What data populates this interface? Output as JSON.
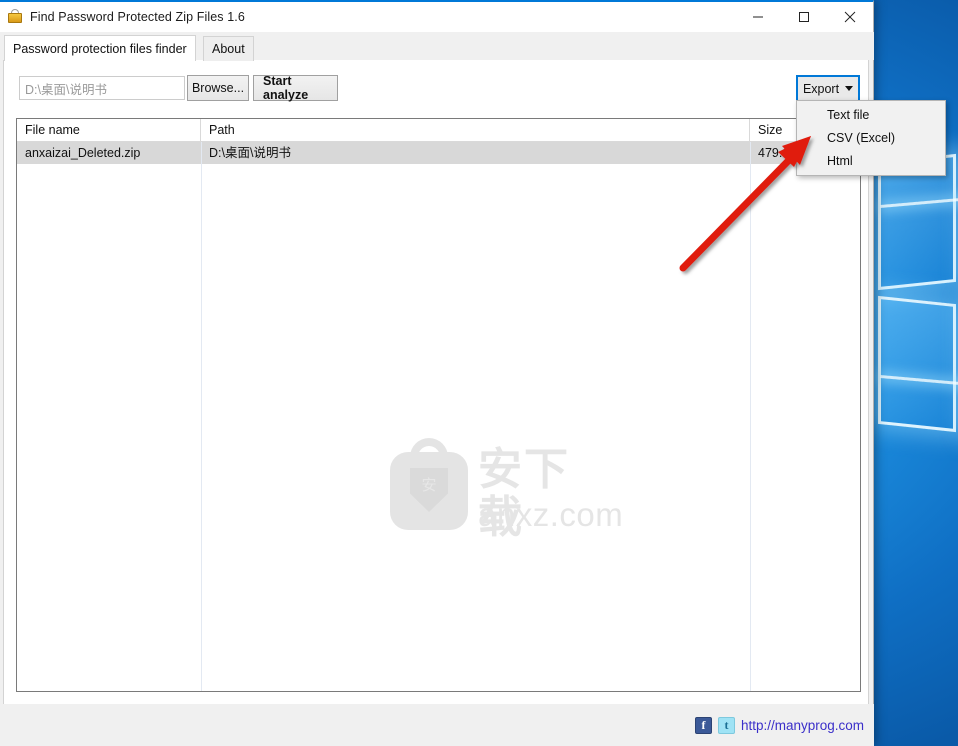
{
  "window": {
    "title": "Find Password Protected Zip Files 1.6",
    "icon": "zip-bag-icon",
    "controls": {
      "minimize": "minimize-icon",
      "maximize": "maximize-icon",
      "close": "close-icon"
    }
  },
  "tabs": [
    {
      "label": "Password protection files finder",
      "active": true
    },
    {
      "label": "About",
      "active": false
    }
  ],
  "toolbar": {
    "path_value": "D:\\桌面\\说明书",
    "path_placeholder": "D:\\桌面\\说明书",
    "browse_label": "Browse...",
    "start_label": "Start analyze",
    "export_label": "Export",
    "export_caret": "chevron-down-icon"
  },
  "export_menu": {
    "open": true,
    "items": [
      {
        "label": "Text file"
      },
      {
        "label": "CSV (Excel)"
      },
      {
        "label": "Html"
      }
    ]
  },
  "table": {
    "columns": [
      "File name",
      "Path",
      "Size"
    ],
    "rows": [
      {
        "file_name": "anxaizai_Deleted.zip",
        "path": "D:\\桌面\\说明书",
        "size": "479.6 K",
        "selected": true
      }
    ]
  },
  "watermark": {
    "cn_text": "安下载",
    "domain": "anxz.com",
    "shield_glyph": "安"
  },
  "statusbar": {
    "facebook_icon": "facebook-icon",
    "facebook_glyph": "f",
    "twitter_icon": "twitter-icon",
    "twitter_glyph": "t",
    "link_text": "http://manyprog.com"
  },
  "annotation": {
    "arrow_color": "#e01b10"
  },
  "colors": {
    "accent": "#0078d7",
    "link": "#3b2fc9",
    "selection": "#d8d8d8",
    "window_border": "#0078d7"
  }
}
